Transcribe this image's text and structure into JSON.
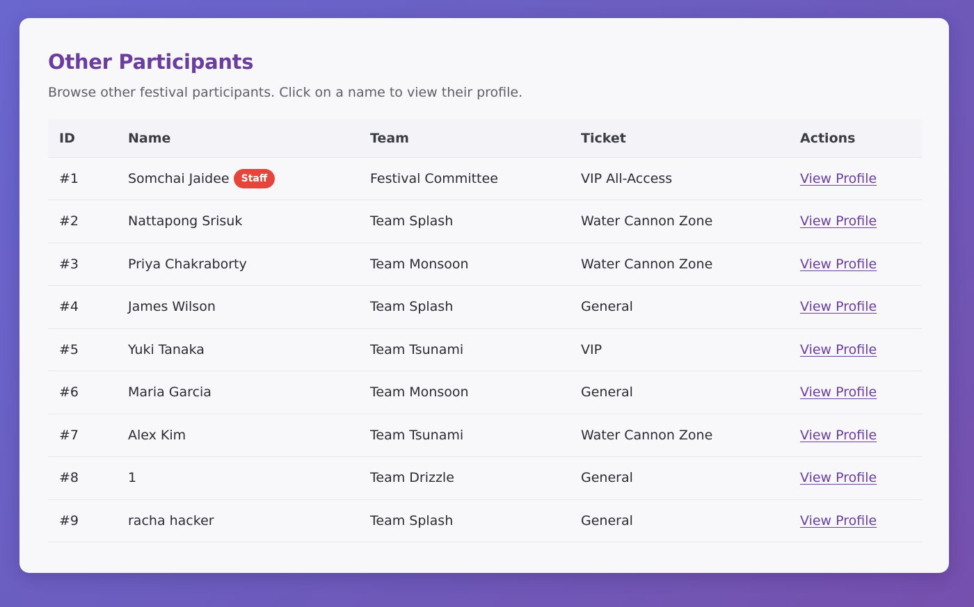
{
  "page": {
    "title": "Other Participants",
    "subtitle": "Browse other festival participants. Click on a name to view their profile."
  },
  "table": {
    "headers": {
      "id": "ID",
      "name": "Name",
      "team": "Team",
      "ticket": "Ticket",
      "actions": "Actions"
    },
    "rows": [
      {
        "id": "#1",
        "name": "Somchai Jaidee",
        "badge": "Staff",
        "team": "Festival Committee",
        "ticket": "VIP All-Access",
        "action": "View Profile"
      },
      {
        "id": "#2",
        "name": "Nattapong Srisuk",
        "team": "Team Splash",
        "ticket": "Water Cannon Zone",
        "action": "View Profile"
      },
      {
        "id": "#3",
        "name": "Priya Chakraborty",
        "team": "Team Monsoon",
        "ticket": "Water Cannon Zone",
        "action": "View Profile"
      },
      {
        "id": "#4",
        "name": "James Wilson",
        "team": "Team Splash",
        "ticket": "General",
        "action": "View Profile"
      },
      {
        "id": "#5",
        "name": "Yuki Tanaka",
        "team": "Team Tsunami",
        "ticket": "VIP",
        "action": "View Profile"
      },
      {
        "id": "#6",
        "name": "Maria Garcia",
        "team": "Team Monsoon",
        "ticket": "General",
        "action": "View Profile"
      },
      {
        "id": "#7",
        "name": "Alex Kim",
        "team": "Team Tsunami",
        "ticket": "Water Cannon Zone",
        "action": "View Profile"
      },
      {
        "id": "#8",
        "name": "1",
        "team": "Team Drizzle",
        "ticket": "General",
        "action": "View Profile"
      },
      {
        "id": "#9",
        "name": "racha hacker",
        "team": "Team Splash",
        "ticket": "General",
        "action": "View Profile"
      }
    ]
  },
  "colors": {
    "accent": "#6a3d9e",
    "badge": "#e5453a",
    "background_start": "#6a67cf",
    "background_end": "#7650ad"
  }
}
